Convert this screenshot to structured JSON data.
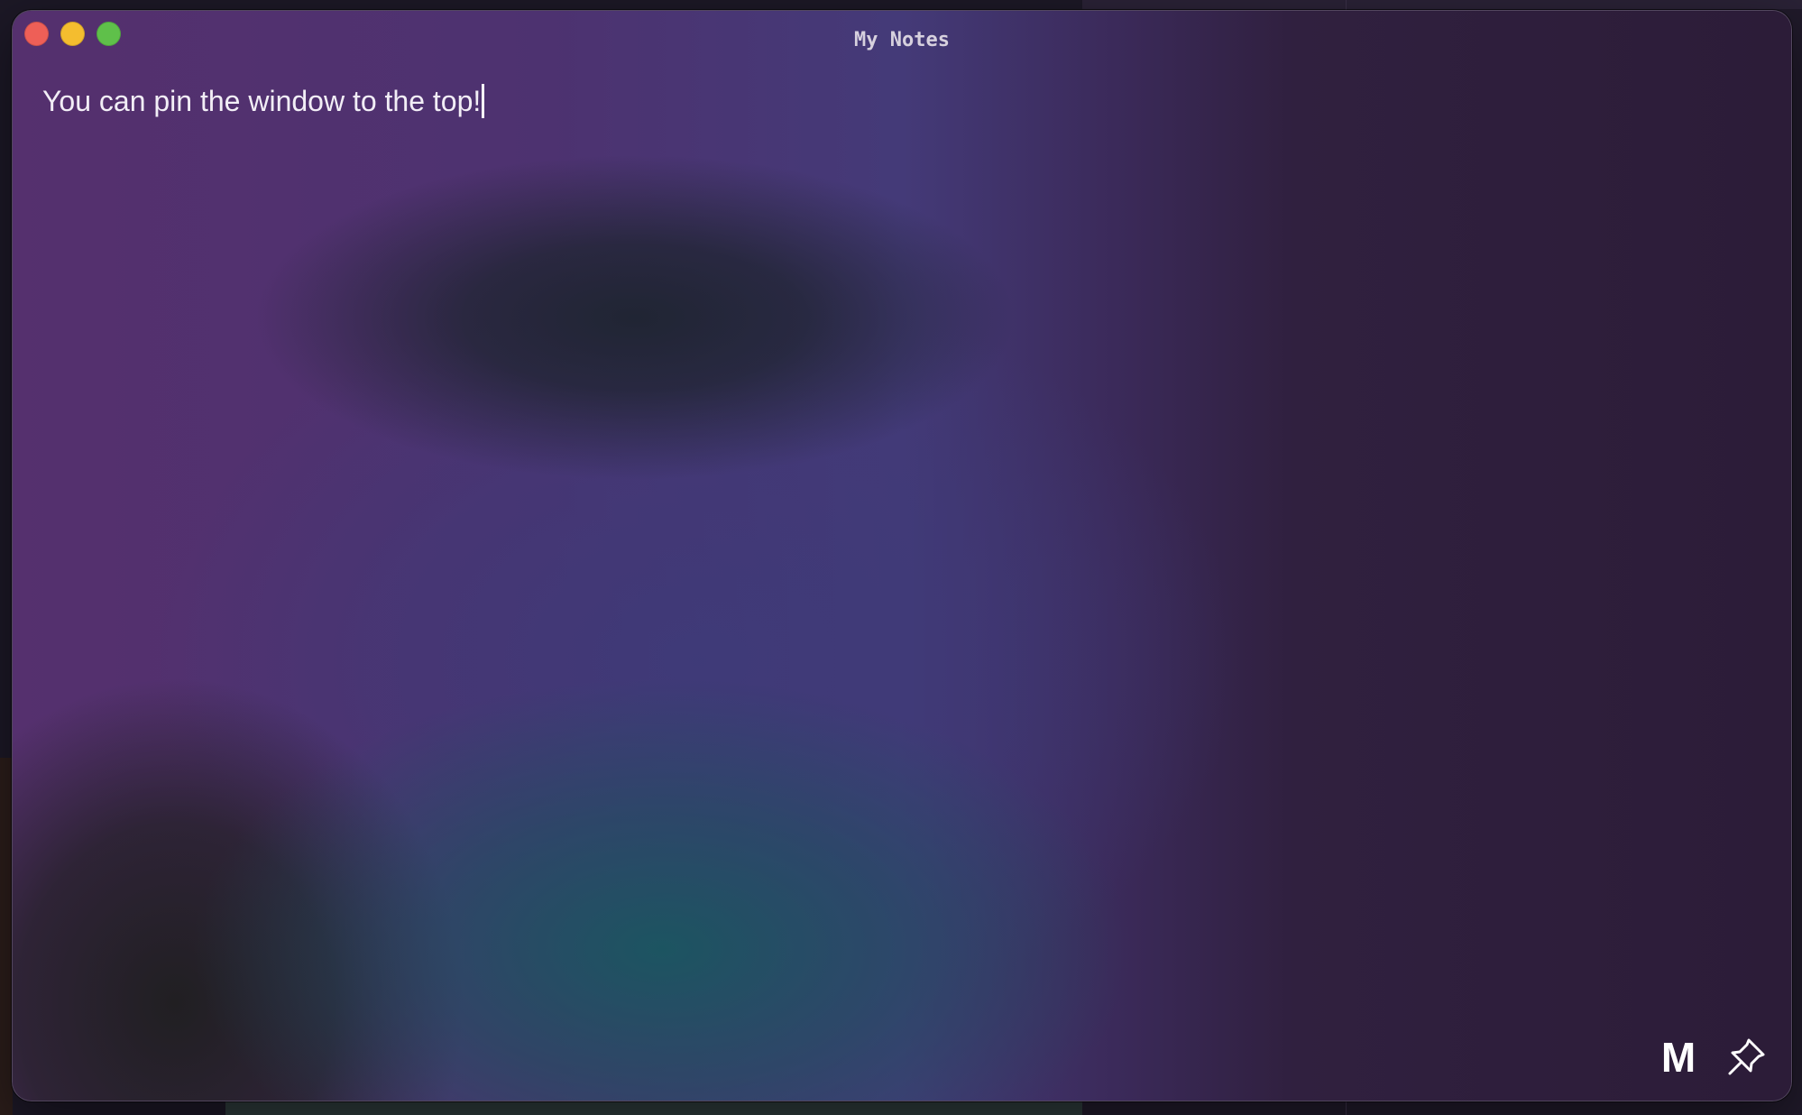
{
  "window": {
    "title": "My Notes"
  },
  "note": {
    "text": "You can pin the window to the top!"
  },
  "toolbar": {
    "markdown_label": "M",
    "pin_icon": "pin-icon"
  },
  "colors": {
    "close": "#ee5f57",
    "minimize": "#f4bd2f",
    "maximize": "#5fc04a",
    "text": "#f2eef6"
  }
}
